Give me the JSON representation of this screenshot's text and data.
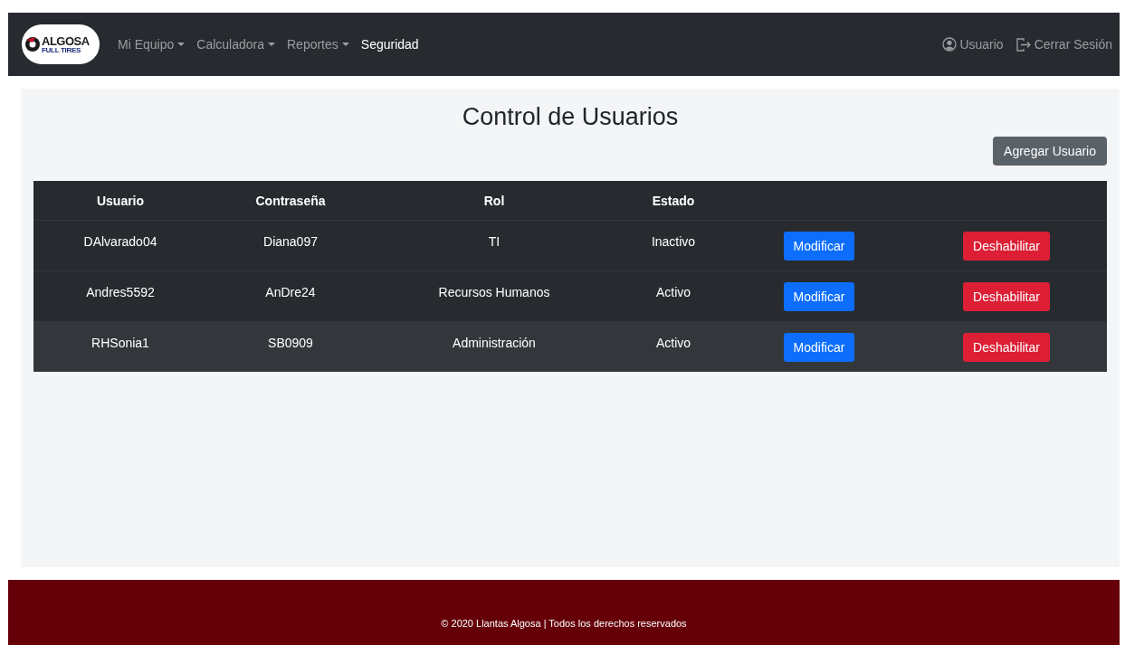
{
  "navbar": {
    "logo": {
      "title": "ALGOSA",
      "subtitle": "FULL TIRES"
    },
    "menu": [
      {
        "label": "Mi Equipo",
        "dropdown": true,
        "selected": false
      },
      {
        "label": "Calculadora",
        "dropdown": true,
        "selected": false
      },
      {
        "label": "Reportes",
        "dropdown": true,
        "selected": false
      },
      {
        "label": "Seguridad",
        "dropdown": false,
        "selected": true
      }
    ],
    "user": "Usuario",
    "logout": "Cerrar Sesión"
  },
  "page": {
    "title": "Control de Usuarios",
    "add_button": "Agregar Usuario"
  },
  "table": {
    "columns": [
      "Usuario",
      "Contraseña",
      "Rol",
      "Estado"
    ],
    "rows": [
      {
        "cells": [
          "DAlvarado04",
          "Diana097",
          "TI",
          "Inactivo"
        ],
        "edit": "Modificar",
        "disable": "Deshabilitar",
        "highlighted": false
      },
      {
        "cells": [
          "Andres5592",
          "AnDre24",
          "Recursos Humanos",
          "Activo"
        ],
        "edit": "Modificar",
        "disable": "Deshabilitar",
        "highlighted": false
      },
      {
        "cells": [
          "RHSonia1",
          "SB0909",
          "Administración",
          "Activo"
        ],
        "edit": "Modificar",
        "disable": "Deshabilitar",
        "highlighted": true
      }
    ]
  },
  "footer": "© 2020 Llantas Algosa | Todos los derechos reservados"
}
